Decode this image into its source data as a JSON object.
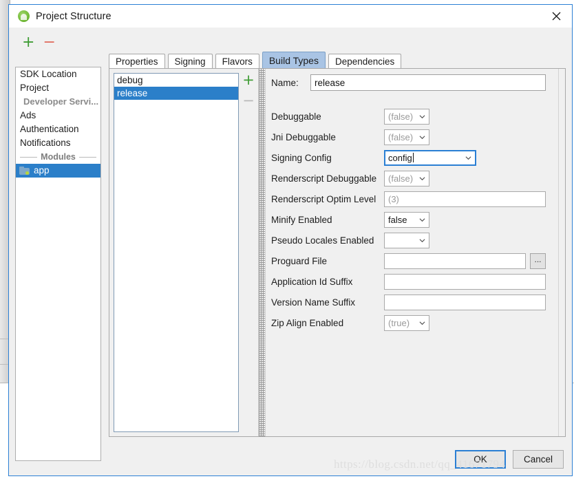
{
  "window": {
    "title": "Project Structure",
    "icon": "android-robot-icon",
    "close_label": "✕"
  },
  "toolbar": {
    "add_label": "+",
    "remove_label": "−"
  },
  "sidebar": {
    "items": [
      {
        "label": "SDK Location",
        "type": "item",
        "selected": false
      },
      {
        "label": "Project",
        "type": "item",
        "selected": false
      },
      {
        "label": "Developer Servi...",
        "type": "muted",
        "selected": false
      },
      {
        "label": "Ads",
        "type": "item",
        "selected": false
      },
      {
        "label": "Authentication",
        "type": "item",
        "selected": false
      },
      {
        "label": "Notifications",
        "type": "item",
        "selected": false
      },
      {
        "label": "Modules",
        "type": "separator",
        "selected": false
      },
      {
        "label": "app",
        "type": "module",
        "selected": true
      }
    ]
  },
  "tabs": [
    {
      "label": "Properties",
      "active": false
    },
    {
      "label": "Signing",
      "active": false
    },
    {
      "label": "Flavors",
      "active": false
    },
    {
      "label": "Build Types",
      "active": true
    },
    {
      "label": "Dependencies",
      "active": false
    }
  ],
  "build_types": {
    "items": [
      {
        "label": "debug",
        "selected": false
      },
      {
        "label": "release",
        "selected": true
      }
    ],
    "add_label": "+",
    "remove_label": "−"
  },
  "form": {
    "name_label": "Name:",
    "name_value": "release",
    "fields": [
      {
        "label": "Debuggable",
        "kind": "combo",
        "value": "(false)",
        "placeholder": true,
        "focused": false
      },
      {
        "label": "Jni Debuggable",
        "kind": "combo",
        "value": "(false)",
        "placeholder": true,
        "focused": false
      },
      {
        "label": "Signing Config",
        "kind": "combo-wide",
        "value": "config",
        "placeholder": false,
        "focused": true
      },
      {
        "label": "Renderscript Debuggable",
        "kind": "combo",
        "value": "(false)",
        "placeholder": true,
        "focused": false
      },
      {
        "label": "Renderscript Optim Level",
        "kind": "text",
        "value": "(3)",
        "placeholder": true,
        "focused": false
      },
      {
        "label": "Minify Enabled",
        "kind": "combo",
        "value": "false",
        "placeholder": false,
        "focused": false
      },
      {
        "label": "Pseudo Locales Enabled",
        "kind": "combo",
        "value": "",
        "placeholder": false,
        "focused": false
      },
      {
        "label": "Proguard File",
        "kind": "text-browse",
        "value": "",
        "placeholder": false,
        "focused": false,
        "browse_label": "..."
      },
      {
        "label": "Application Id Suffix",
        "kind": "text",
        "value": "",
        "placeholder": false,
        "focused": false
      },
      {
        "label": "Version Name Suffix",
        "kind": "text",
        "value": "",
        "placeholder": false,
        "focused": false
      },
      {
        "label": "Zip Align Enabled",
        "kind": "combo",
        "value": "(true)",
        "placeholder": true,
        "focused": false
      }
    ]
  },
  "buttons": {
    "ok": "OK",
    "cancel": "Cancel"
  },
  "watermark": "https://blog.csdn.net/qq_41671794",
  "colors": {
    "selection_blue": "#2b7fc9",
    "focus_blue": "#2a7fd4",
    "tab_active": "#a9c4e4",
    "add_green": "#3f9c35",
    "remove_red": "#e06c5e"
  }
}
